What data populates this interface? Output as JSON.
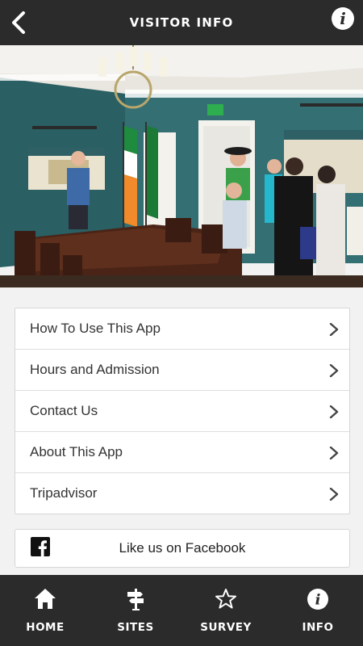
{
  "header": {
    "title": "VISITOR INFO",
    "back_icon": "chevron-left-icon",
    "info_icon": "info-icon",
    "info_glyph": "i"
  },
  "hero_image": {
    "description_icon": "photo-icon"
  },
  "menu": {
    "items": [
      {
        "label": "How To Use This App"
      },
      {
        "label": "Hours and Admission"
      },
      {
        "label": "Contact Us"
      },
      {
        "label": "About This App"
      },
      {
        "label": "Tripadvisor"
      }
    ]
  },
  "facebook": {
    "label": "Like us on Facebook",
    "icon": "facebook-icon",
    "icon_glyph": "f"
  },
  "tabbar": {
    "tabs": [
      {
        "label": "HOME",
        "icon": "home-icon"
      },
      {
        "label": "SITES",
        "icon": "signpost-icon"
      },
      {
        "label": "SURVEY",
        "icon": "star-icon"
      },
      {
        "label": "INFO",
        "icon": "info-icon"
      }
    ],
    "info_glyph": "i"
  },
  "colors": {
    "bar": "#2b2b2b",
    "background": "#f2f2f2",
    "wall": "#2f6a6e"
  }
}
